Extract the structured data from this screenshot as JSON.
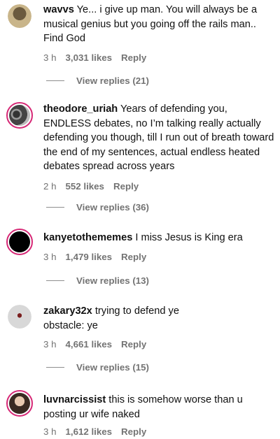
{
  "comments": [
    {
      "username": "wavvs",
      "text": "Ye... i give up man. You will always be a musical genius but you going off the rails man.. Find God",
      "time": "3 h",
      "likes": "3,031 likes",
      "reply_label": "Reply",
      "view_replies": "View replies (21)"
    },
    {
      "username": "theodore_uriah",
      "text": "Years of defending you, ENDLESS debates, no I’m talking really actually defending you though, till I run out of breath toward the end of my sentences, actual endless heated debates spread across years",
      "time": "2 h",
      "likes": "552 likes",
      "reply_label": "Reply",
      "view_replies": "View replies (36)"
    },
    {
      "username": "kanyetothememes",
      "text": "I miss Jesus is King era",
      "time": "3 h",
      "likes": "1,479 likes",
      "reply_label": "Reply",
      "view_replies": "View replies (13)"
    },
    {
      "username": "zakary32x",
      "text": "trying to defend ye",
      "text_line2": "obstacle: ye",
      "time": "3 h",
      "likes": "4,661 likes",
      "reply_label": "Reply",
      "view_replies": "View replies (15)"
    },
    {
      "username": "luvnarcissist",
      "text": "this is somehow worse than u posting ur wife naked",
      "time": "3 h",
      "likes": "1,612 likes",
      "reply_label": "Reply"
    }
  ],
  "colors": {
    "story_ring": "#d62976",
    "meta_text": "#737373"
  }
}
